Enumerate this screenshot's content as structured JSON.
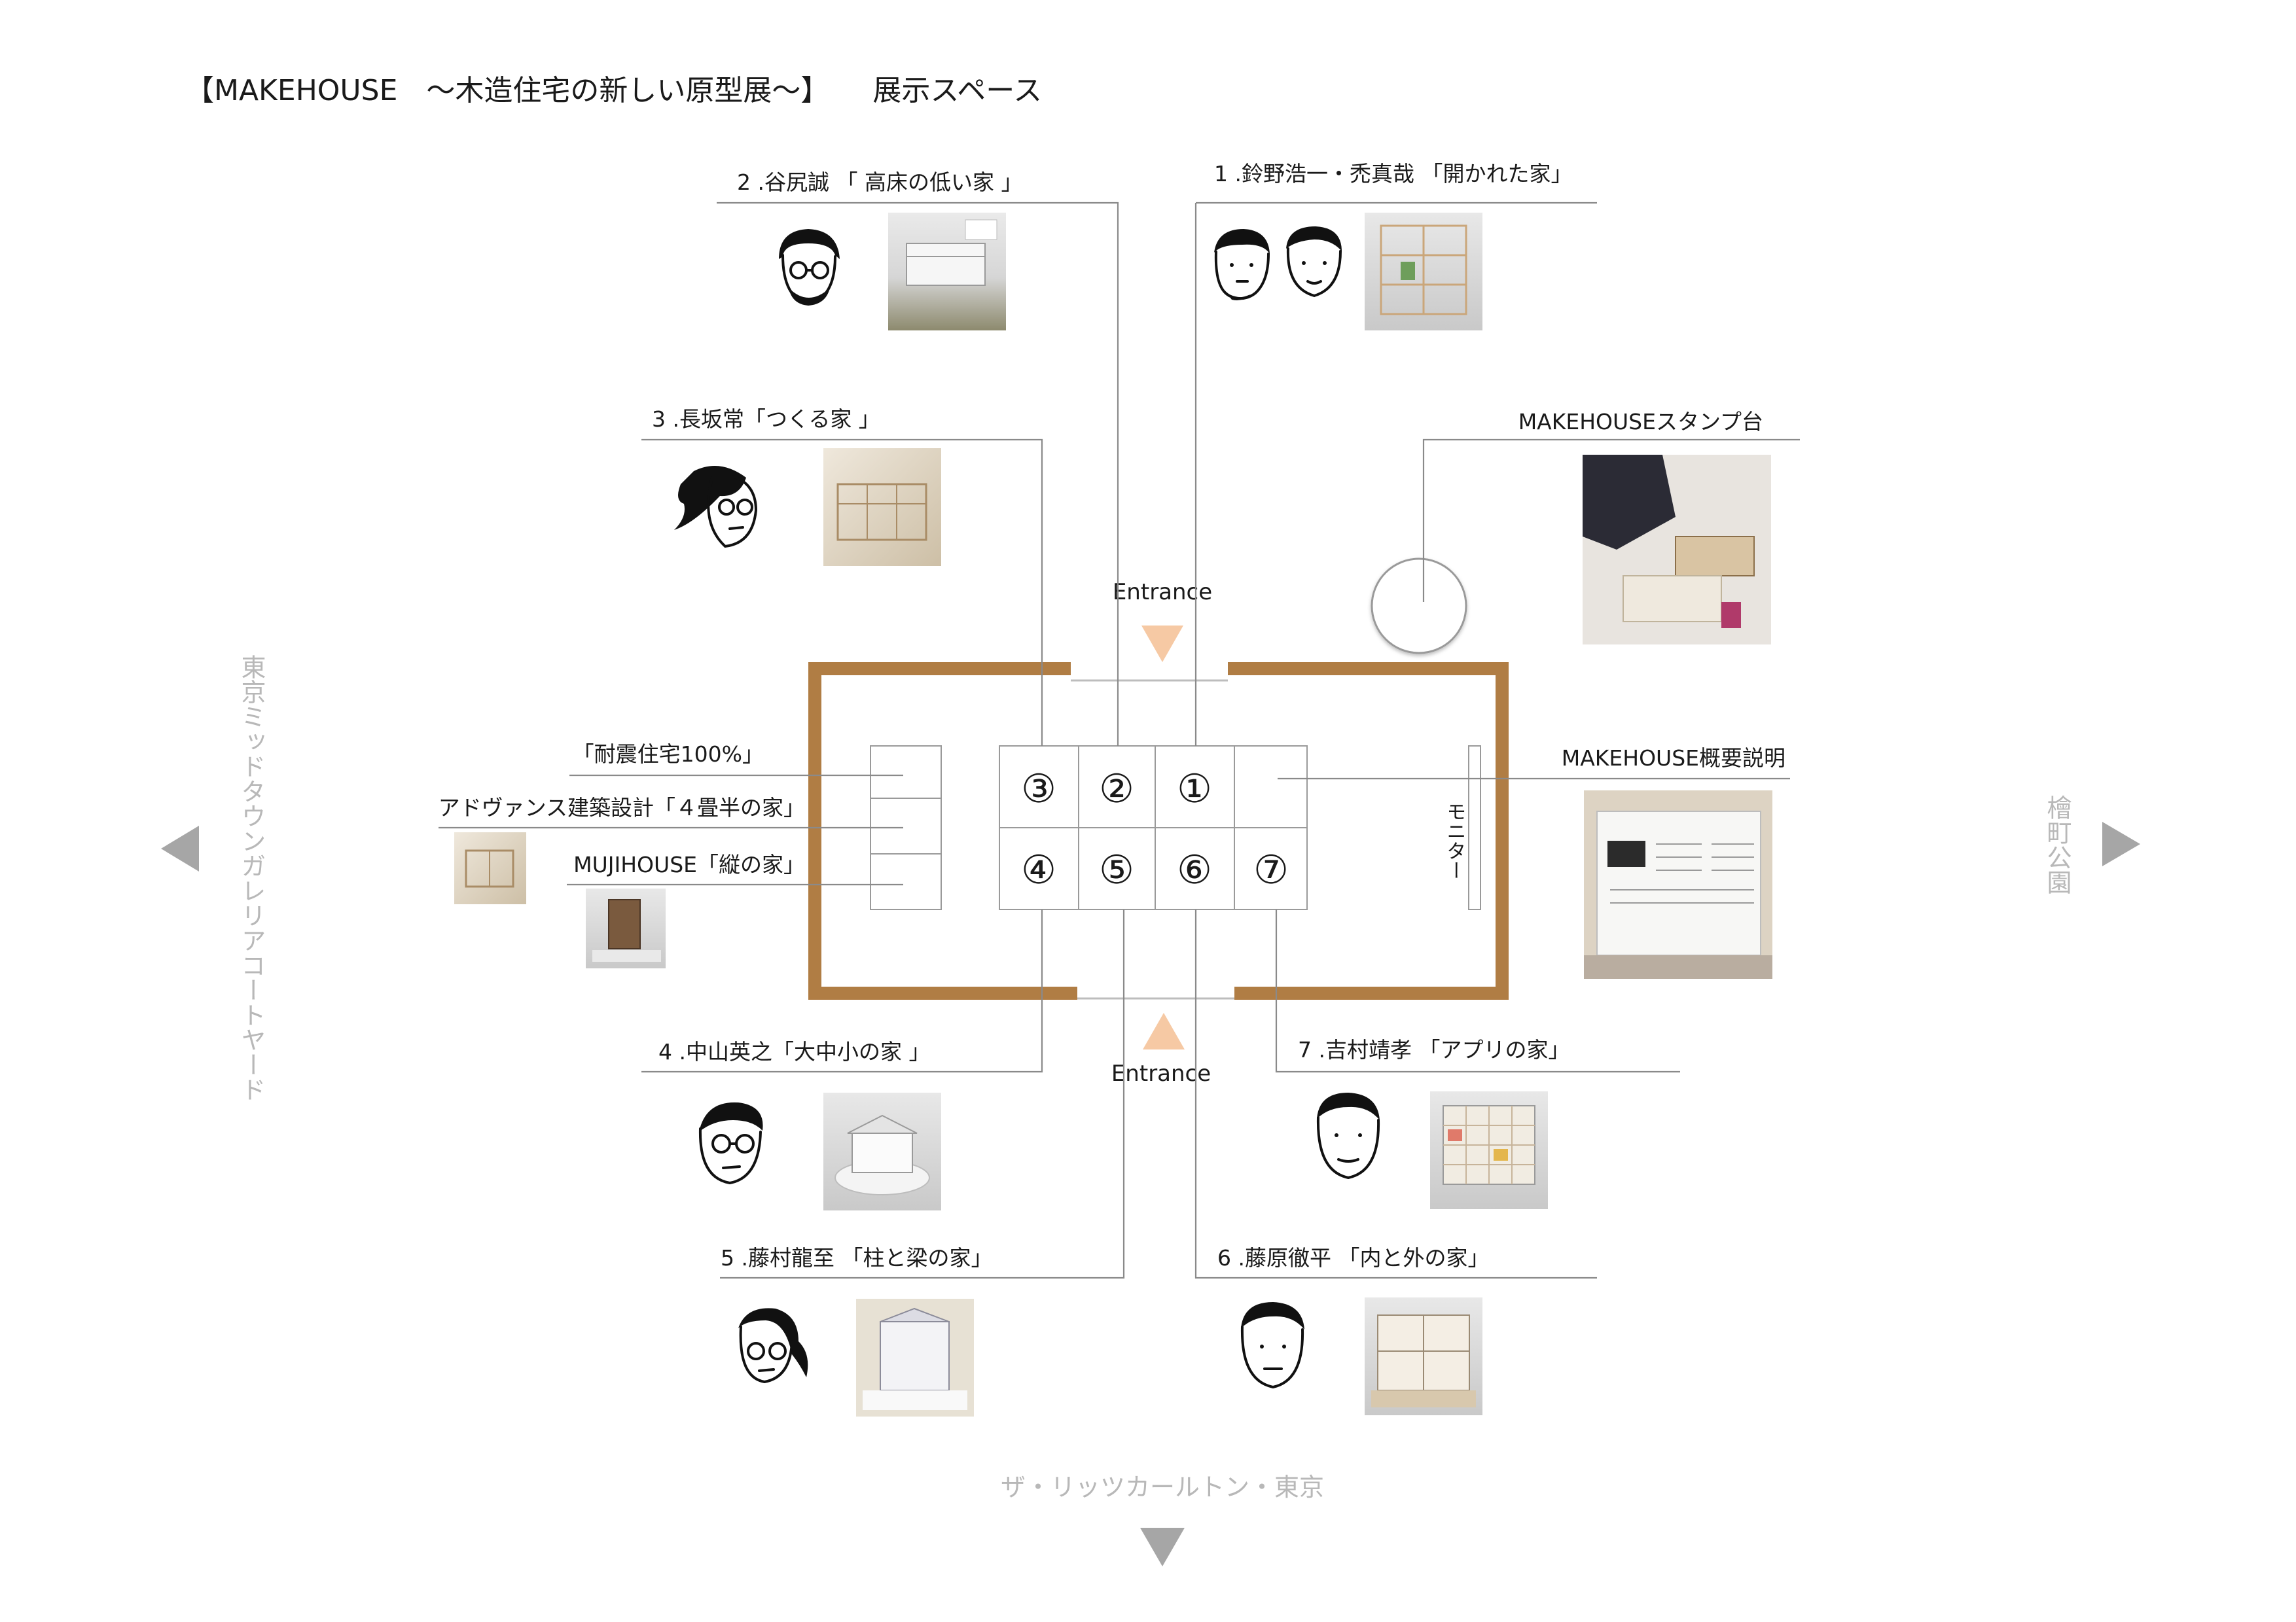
{
  "title": "【MAKEHOUSE　～木造住宅の新しい原型展～】　　展示スペース",
  "entrances": {
    "top": "Entrance",
    "bottom": "Entrance"
  },
  "streets": {
    "left": "東京ミッドタウンガレリアコートヤード",
    "right": "檜町公園",
    "bottom": "ザ・リッツカールトン・東京"
  },
  "monitor": "モニター",
  "booth_numbers": [
    "①",
    "②",
    "③",
    "④",
    "⑤",
    "⑥",
    "⑦"
  ],
  "exhibits": {
    "e1": "1 .鈴野浩一・禿真哉 「開かれた家」",
    "e2": "2 .谷尻誠 「 高床の低い家 」",
    "e3": "3 .長坂常「つくる家 」",
    "e4": "4 .中山英之「大中小の家 」",
    "e5": "5 .藤村龍至 「柱と梁の家」",
    "e6": "6 .藤原徹平 「内と外の家」",
    "e7": "7 .吉村靖孝 「アプリの家」"
  },
  "side_labels": {
    "stamp": "MAKEHOUSEスタンプ台",
    "overview": "MAKEHOUSE概要説明",
    "taishin": "「耐震住宅100%」",
    "advance": "アドヴァンス建築設計「４畳半の家」",
    "muji": "MUJIHOUSE「縦の家」"
  },
  "colors": {
    "wall": "#b07d44",
    "entrance_arrow": "#f6c9a4",
    "street_text": "#b8b8b8",
    "nav_arrow": "#a6a6a6"
  }
}
